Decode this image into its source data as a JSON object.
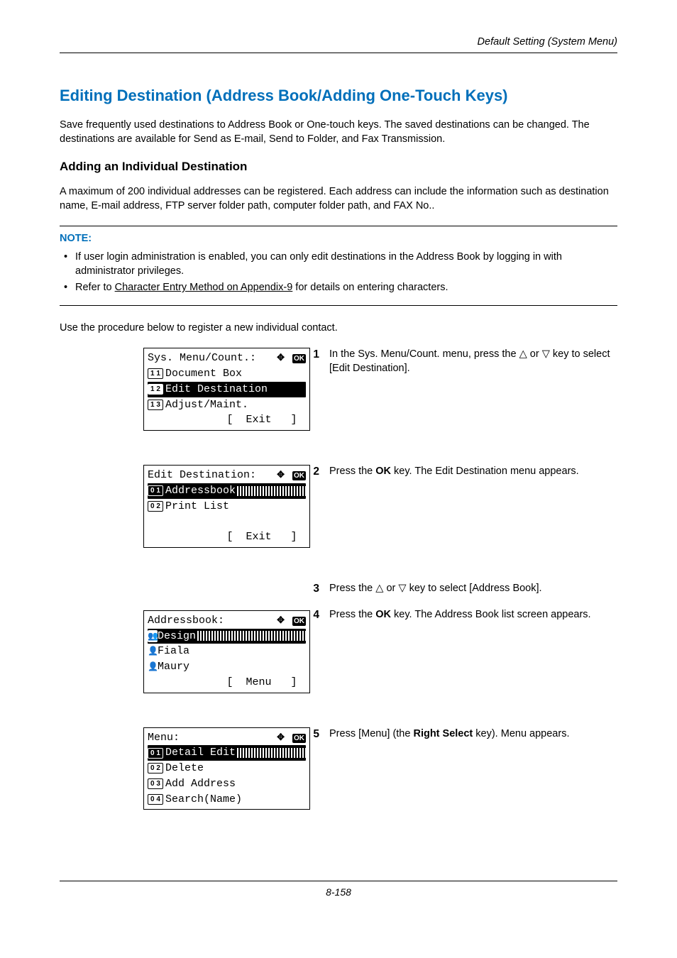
{
  "header": {
    "section": "Default Setting (System Menu)"
  },
  "h1": "Editing Destination (Address Book/Adding One-Touch Keys)",
  "intro": "Save frequently used destinations to Address Book or One-touch keys. The saved destinations can be changed. The destinations are available for Send as E-mail, Send to Folder, and Fax Transmission.",
  "h2": "Adding an Individual Destination",
  "body": "A maximum of 200 individual addresses can be registered. Each address can include the information such as destination name, E-mail address, FTP server folder path, computer folder path, and FAX No..",
  "note": {
    "title": "NOTE:",
    "items": [
      {
        "text": "If user login administration is enabled, you can only edit destinations in the Address Book by logging in with administrator privileges."
      },
      {
        "prefix": "Refer to ",
        "link": "Character Entry Method on Appendix-9",
        "suffix": " for details on entering characters."
      }
    ]
  },
  "lead": "Use the procedure below to register a new individual contact.",
  "ok": "OK",
  "lcd1": {
    "title": "Sys. Menu/Count.:",
    "r1_num": "1 1",
    "r1": "Document Box",
    "r2_num": "1 2",
    "r2": "Edit Destination",
    "r3_num": "1 3",
    "r3": "Adjust/Maint.",
    "soft": "[  Exit   ]"
  },
  "lcd2": {
    "title": "Edit Destination:",
    "r1_num": "0 1",
    "r1": "Addressbook",
    "r2_num": "0 2",
    "r2": "Print List",
    "soft": "[  Exit   ]"
  },
  "lcd3": {
    "title": "Addressbook:",
    "r1": "Design",
    "r2": "Fiala",
    "r3": "Maury",
    "soft": "[  Menu   ]"
  },
  "lcd4": {
    "title": "Menu:",
    "r1_num": "0 1",
    "r1": "Detail Edit",
    "r2_num": "0 2",
    "r2": "Delete",
    "r3_num": "0 3",
    "r3": "Add Address",
    "r4_num": "0 4",
    "r4": "Search(Name)"
  },
  "steps": {
    "s1": {
      "num": "1",
      "pre": "In the Sys. Menu/Count. menu, press the ",
      "post": " key to select [Edit Destination]."
    },
    "s2": {
      "num": "2",
      "pre": "Press the ",
      "key": "OK",
      "post": " key. The Edit Destination menu appears."
    },
    "s3": {
      "num": "3",
      "pre": "Press the ",
      "post": " key to select [Address Book]."
    },
    "s4": {
      "num": "4",
      "pre": "Press the ",
      "key": "OK",
      "post": " key. The Address Book list screen appears."
    },
    "s5": {
      "num": "5",
      "pre": "Press [Menu] (the ",
      "key": "Right Select",
      "post": " key). Menu appears."
    }
  },
  "tri_or": " or ",
  "tri_up": "△",
  "tri_down": "▽",
  "footer": "8-158"
}
